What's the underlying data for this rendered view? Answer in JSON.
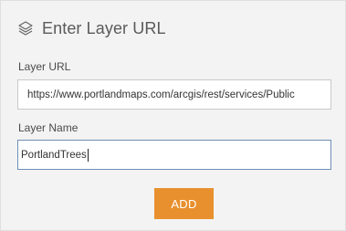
{
  "header": {
    "icon": "layers-icon",
    "title": "Enter Layer URL"
  },
  "form": {
    "layer_url": {
      "label": "Layer URL",
      "value": "https://www.portlandmaps.com/arcgis/rest/services/Public"
    },
    "layer_name": {
      "label": "Layer Name",
      "value": "PortlandTrees"
    },
    "add_button_label": "ADD"
  },
  "colors": {
    "accent": "#e8902e",
    "focus_border": "#6e8fb8",
    "background": "#f3f3f3"
  }
}
